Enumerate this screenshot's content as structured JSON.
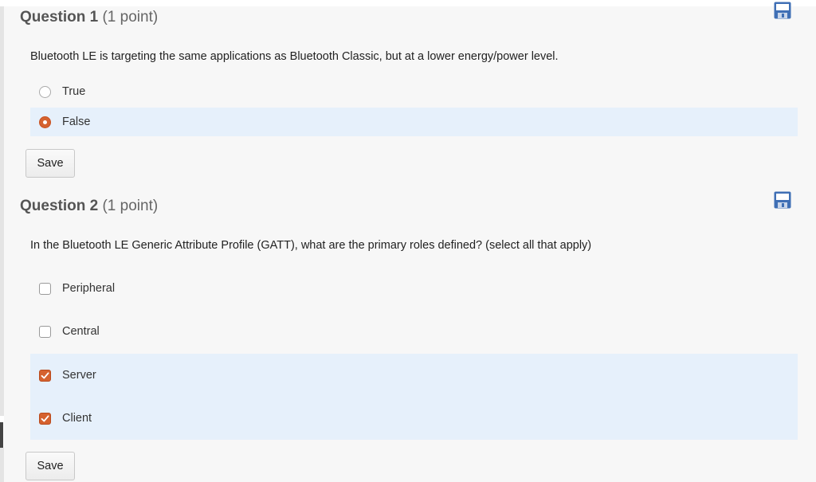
{
  "questions": [
    {
      "title": "Question 1",
      "points": "(1 point)",
      "prompt": "Bluetooth LE is targeting the same applications as Bluetooth Classic, but at a lower energy/power level.",
      "type": "radio",
      "choices": [
        {
          "label": "True",
          "checked": false
        },
        {
          "label": "False",
          "checked": true
        }
      ],
      "save_label": "Save"
    },
    {
      "title": "Question 2",
      "points": "(1 point)",
      "prompt": "In the Bluetooth LE Generic Attribute Profile (GATT), what are the primary roles defined? (select all that apply)",
      "type": "checkbox",
      "choices": [
        {
          "label": "Peripheral",
          "checked": false
        },
        {
          "label": "Central",
          "checked": false
        },
        {
          "label": "Server",
          "checked": true
        },
        {
          "label": "Client",
          "checked": true
        }
      ],
      "save_label": "Save"
    }
  ],
  "icons": {
    "save": "floppy-disk-icon"
  },
  "colors": {
    "accent": "#d5622f",
    "selected_bg": "#e6f0fb",
    "save_icon": "#3f6fb5"
  }
}
